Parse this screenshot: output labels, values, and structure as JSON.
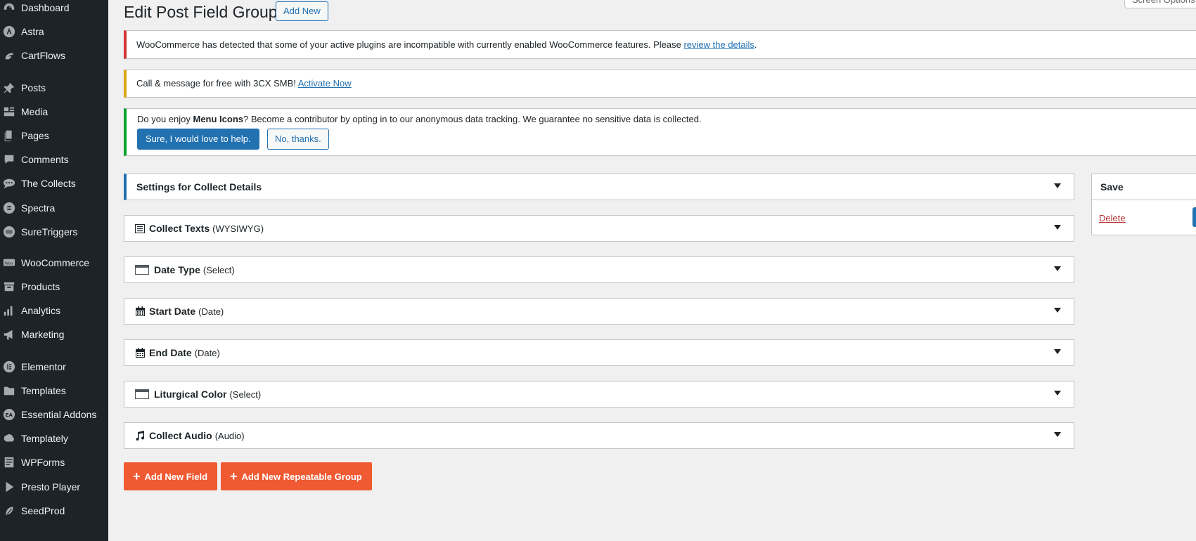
{
  "sidebar": {
    "items": [
      {
        "label": "Dashboard",
        "icon": "dashboard-icon"
      },
      {
        "label": "Astra",
        "icon": "astra-icon"
      },
      {
        "label": "CartFlows",
        "icon": "cartflows-icon"
      },
      {
        "label": "Posts",
        "icon": "pushpin-icon"
      },
      {
        "label": "Media",
        "icon": "media-icon"
      },
      {
        "label": "Pages",
        "icon": "pages-icon"
      },
      {
        "label": "Comments",
        "icon": "comment-icon"
      },
      {
        "label": "The Collects",
        "icon": "chat-bubbles-icon"
      },
      {
        "label": "Spectra",
        "icon": "spectra-icon"
      },
      {
        "label": "SureTriggers",
        "icon": "suretriggers-icon"
      },
      {
        "label": "WooCommerce",
        "icon": "woo-icon"
      },
      {
        "label": "Products",
        "icon": "archive-box-icon"
      },
      {
        "label": "Analytics",
        "icon": "bar-chart-icon"
      },
      {
        "label": "Marketing",
        "icon": "megaphone-icon"
      },
      {
        "label": "Elementor",
        "icon": "elementor-icon"
      },
      {
        "label": "Templates",
        "icon": "folder-icon"
      },
      {
        "label": "Essential Addons",
        "icon": "ea-icon"
      },
      {
        "label": "Templately",
        "icon": "templately-icon"
      },
      {
        "label": "WPForms",
        "icon": "forms-icon"
      },
      {
        "label": "Presto Player",
        "icon": "presto-icon"
      },
      {
        "label": "SeedProd",
        "icon": "seedprod-icon"
      }
    ]
  },
  "header": {
    "title": "Edit Post Field Group",
    "add_new": "Add New",
    "screen_options": "Screen Options"
  },
  "notices": {
    "woo": {
      "text": "WooCommerce has detected that some of your active plugins are incompatible with currently enabled WooCommerce features. Please ",
      "link": "review the details",
      "suffix": "."
    },
    "cx": {
      "text": "Call & message for free with 3CX SMB! ",
      "link": "Activate Now"
    },
    "menu_icons": {
      "pre": "Do you enjoy ",
      "bold": "Menu Icons",
      "post": "? Become a contributor by opting in to our anonymous data tracking. We guarantee no sensitive data is collected.",
      "yes_button": "Sure, I would love to help.",
      "no_button": "No, thanks."
    }
  },
  "settings_box": {
    "title": "Settings for Collect Details"
  },
  "fields": [
    {
      "name": "Collect Texts",
      "type": "(WYSIWYG)",
      "icon": "text-editor-icon"
    },
    {
      "name": "Date Type",
      "type": "(Select)",
      "icon": "select-box-icon"
    },
    {
      "name": "Start Date",
      "type": "(Date)",
      "icon": "calendar-icon"
    },
    {
      "name": "End Date",
      "type": "(Date)",
      "icon": "calendar-icon"
    },
    {
      "name": "Liturgical Color",
      "type": "(Select)",
      "icon": "select-box-icon"
    },
    {
      "name": "Collect Audio",
      "type": "(Audio)",
      "icon": "music-note-icon"
    }
  ],
  "save_box": {
    "title": "Save",
    "delete": "Delete"
  },
  "actions": {
    "add_field": "Add New Field",
    "add_group": "Add New Repeatable Group"
  },
  "colors": {
    "sidebar_bg": "#1d2327",
    "accent": "#2271b1",
    "orange": "#f05a32",
    "notice_error": "#d63638",
    "notice_warning": "#dba617",
    "notice_success": "#00a32a"
  }
}
